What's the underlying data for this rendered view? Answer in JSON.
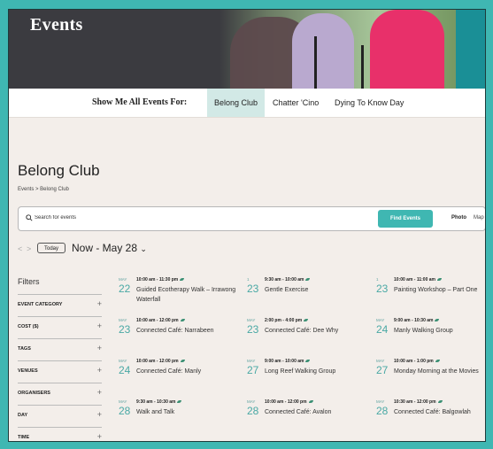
{
  "hero": {
    "title": "Events"
  },
  "show_bar": {
    "label": "Show Me All Events For:",
    "chips": [
      "Belong Club",
      "Chatter 'Cino",
      "Dying To Know Day"
    ],
    "active": "Belong Club"
  },
  "page": {
    "title": "Belong Club",
    "breadcrumb": "Events > Belong Club"
  },
  "search": {
    "placeholder": "Search for events",
    "find_label": "Find Events",
    "view_photo": "Photo",
    "view_map": "Map"
  },
  "nav": {
    "prev": "<",
    "next": ">",
    "today_label": "Today",
    "range_label": "Now - May 28",
    "range_chevron": "⌄"
  },
  "filters": {
    "title": "Filters",
    "items": [
      "EVENT CATEGORY",
      "COST ($)",
      "TAGS",
      "VENUES",
      "ORGANISERS",
      "DAY",
      "TIME"
    ],
    "expand": "+"
  },
  "events": [
    {
      "month": "MAY",
      "day": "22",
      "time": "10:00 am - 11:30 pm",
      "title": "Guided Ecotherapy Walk – Irrawong Waterfall"
    },
    {
      "month": "1",
      "day": "23",
      "time": "9:30 am - 10:00 am",
      "title": "Gentle Exercise"
    },
    {
      "month": "1",
      "day": "23",
      "time": "10:00 am - 11:00 am",
      "title": "Painting Workshop – Part One"
    },
    {
      "month": "MAY",
      "day": "23",
      "time": "10:00 am - 12:00 pm",
      "title": "Connected Café: Narrabeen"
    },
    {
      "month": "MAY",
      "day": "23",
      "time": "2:00 pm - 4:00 pm",
      "title": "Connected Café: Dee Why"
    },
    {
      "month": "MAY",
      "day": "24",
      "time": "9:00 am - 10:30 am",
      "title": "Manly Walking Group"
    },
    {
      "month": "MAY",
      "day": "24",
      "time": "10:00 am - 12:00 pm",
      "title": "Connected Café: Manly"
    },
    {
      "month": "MAY",
      "day": "27",
      "time": "9:00 am - 10:00 am",
      "title": "Long Reef Walking Group"
    },
    {
      "month": "MAY",
      "day": "27",
      "time": "10:00 am - 1:00 pm",
      "title": "Monday Morning at the Movies"
    },
    {
      "month": "MAY",
      "day": "28",
      "time": "9:30 am - 10:30 am",
      "title": "Walk and Talk"
    },
    {
      "month": "MAY",
      "day": "28",
      "time": "10:00 am - 12:00 pm",
      "title": "Connected Café: Avalon"
    },
    {
      "month": "MAY",
      "day": "28",
      "time": "10:30 am - 12:00 pm",
      "title": "Connected Café: Balgowlah"
    }
  ],
  "colors": {
    "accent": "#3fb7b2",
    "date": "#4aa9a5",
    "active_chip": "#d2e9e6",
    "background": "#f3eeea"
  }
}
